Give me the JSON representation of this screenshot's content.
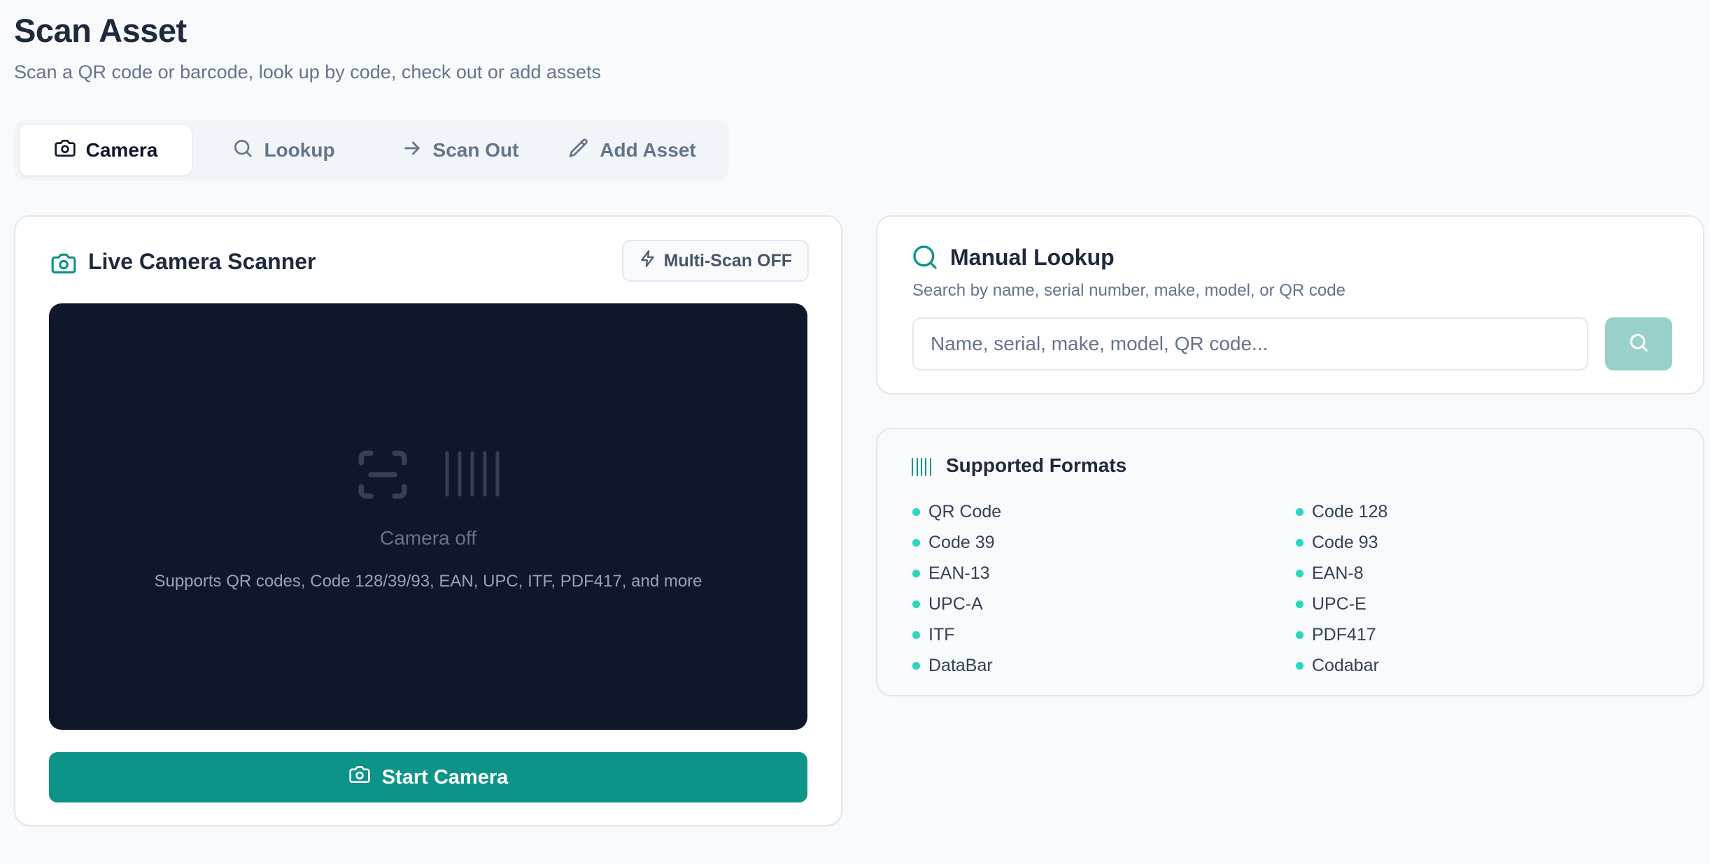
{
  "page": {
    "title": "Scan Asset",
    "subtitle": "Scan a QR code or barcode, look up by code, check out or add assets"
  },
  "tabs": [
    {
      "label": "Camera",
      "icon": "camera-icon",
      "active": true
    },
    {
      "label": "Lookup",
      "icon": "search-icon",
      "active": false
    },
    {
      "label": "Scan Out",
      "icon": "arrow-right-icon",
      "active": false
    },
    {
      "label": "Add Asset",
      "icon": "pencil-icon",
      "active": false
    }
  ],
  "camera": {
    "title": "Live Camera Scanner",
    "multiscan_label": "Multi-Scan OFF",
    "status": "Camera off",
    "hint": "Supports QR codes, Code 128/39/93, EAN, UPC, ITF, PDF417, and more",
    "start_label": "Start Camera"
  },
  "lookup": {
    "title": "Manual Lookup",
    "description": "Search by name, serial number, make, model, or QR code",
    "placeholder": "Name, serial, make, model, QR code...",
    "value": ""
  },
  "formats": {
    "title": "Supported Formats",
    "items": [
      "QR Code",
      "Code 128",
      "Code 39",
      "Code 93",
      "EAN-13",
      "EAN-8",
      "UPC-A",
      "UPC-E",
      "ITF",
      "PDF417",
      "DataBar",
      "Codabar"
    ]
  },
  "colors": {
    "accent": "#0d9488",
    "accent_light": "#99d1ca",
    "dot": "#2dd4bf",
    "viewport_bg": "#0f172a"
  }
}
